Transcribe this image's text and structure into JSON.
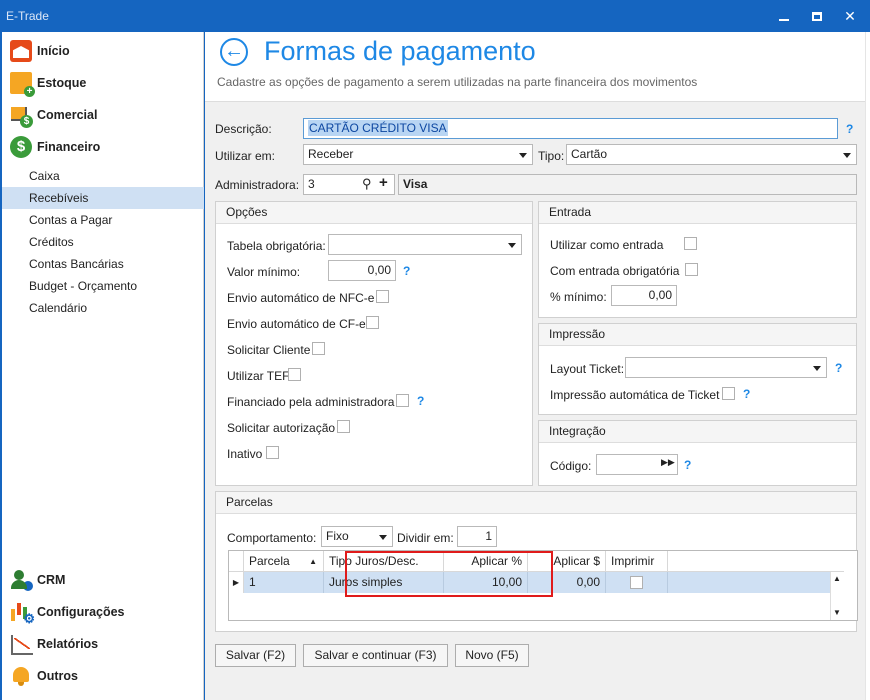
{
  "window": {
    "title": "E-Trade"
  },
  "sidebar": {
    "main_items": [
      {
        "label": "Início",
        "icon": "home-icon"
      },
      {
        "label": "Estoque",
        "icon": "stock-icon"
      },
      {
        "label": "Comercial",
        "icon": "commercial-icon"
      },
      {
        "label": "Financeiro",
        "icon": "finance-icon"
      }
    ],
    "sub_items": [
      "Caixa",
      "Recebíveis",
      "Contas a Pagar",
      "Créditos",
      "Contas Bancárias",
      "Budget - Orçamento",
      "Calendário"
    ],
    "selected_sub": "Recebíveis",
    "bottom_items": [
      {
        "label": "CRM",
        "icon": "crm-icon"
      },
      {
        "label": "Configurações",
        "icon": "settings-icon"
      },
      {
        "label": "Relatórios",
        "icon": "reports-icon"
      },
      {
        "label": "Outros",
        "icon": "bell-icon"
      }
    ]
  },
  "header": {
    "title": "Formas de pagamento",
    "subtitle": "Cadastre as opções de pagamento a serem utilizadas na parte financeira dos movimentos"
  },
  "form": {
    "descricao_label": "Descrição:",
    "descricao_value": "CARTÃO CRÉDITO VISA",
    "help": "?",
    "utilizar_label": "Utilizar em:",
    "utilizar_value": "Receber",
    "tipo_label": "Tipo:",
    "tipo_value": "Cartão",
    "admin_label": "Administradora:",
    "admin_value": "3",
    "admin_name": "Visa"
  },
  "opcoes": {
    "title": "Opções",
    "tabela_label": "Tabela obrigatória:",
    "tabela_value": "",
    "valor_min_label": "Valor mínimo:",
    "valor_min_value": "0,00",
    "nfce_label": "Envio automático de NFC-e",
    "cfe_label": "Envio automático de CF-e",
    "solicitar_cliente_label": "Solicitar Cliente",
    "tef_label": "Utilizar TEF",
    "financiado_label": "Financiado pela administradora",
    "autorizacao_label": "Solicitar autorização",
    "inativo_label": "Inativo"
  },
  "entrada": {
    "title": "Entrada",
    "utilizar_label": "Utilizar como entrada",
    "obrigatoria_label": "Com entrada obrigatória",
    "minimo_label": "% mínimo:",
    "minimo_value": "0,00"
  },
  "impressao": {
    "title": "Impressão",
    "layout_label": "Layout Ticket:",
    "layout_value": "",
    "auto_label": "Impressão automática de Ticket"
  },
  "integracao": {
    "title": "Integração",
    "codigo_label": "Código:",
    "codigo_value": ""
  },
  "parcelas": {
    "title": "Parcelas",
    "comportamento_label": "Comportamento:",
    "comportamento_value": "Fixo",
    "dividir_label": "Dividir em:",
    "dividir_value": "1",
    "columns": [
      "Parcela",
      "Tipo Juros/Desc.",
      "Aplicar %",
      "Aplicar $",
      "Imprimir"
    ],
    "rows": [
      {
        "parcela": "1",
        "tipo": "Juros simples",
        "aplicar_pct": "10,00",
        "aplicar_val": "0,00"
      }
    ]
  },
  "actions": {
    "save": "Salvar (F2)",
    "save_continue": "Salvar e continuar (F3)",
    "new": "Novo (F5)"
  },
  "colors": {
    "accent": "#1e88e5",
    "titlebar": "#1565c0",
    "highlight": "#e01b1b",
    "selected_row": "#cfe0f3"
  }
}
